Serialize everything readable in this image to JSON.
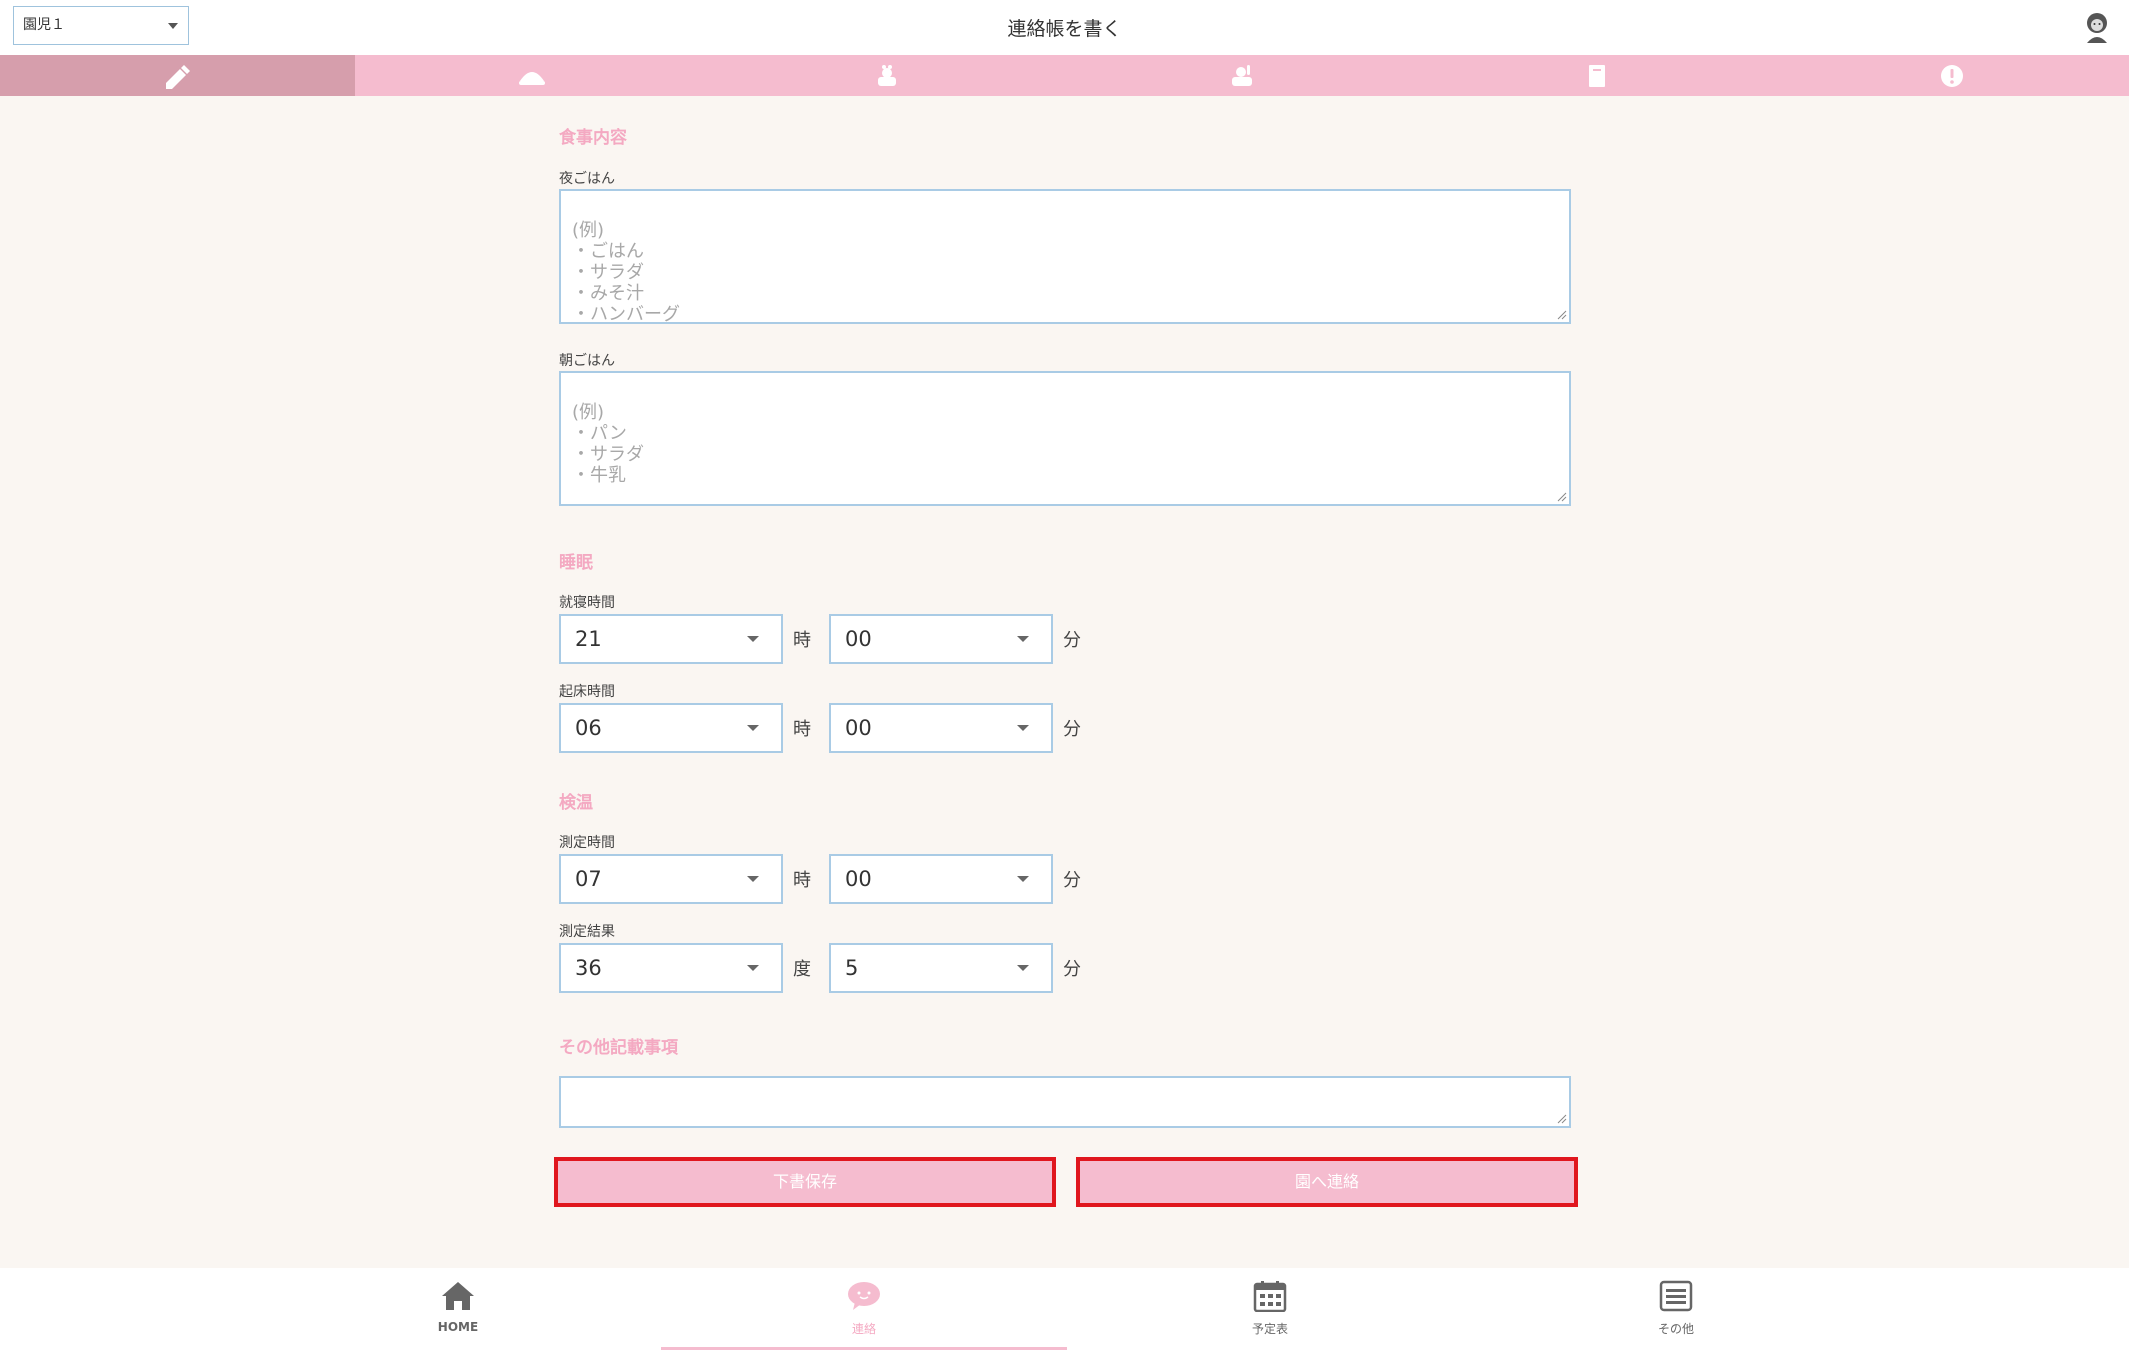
{
  "header": {
    "child_select": "園児１",
    "title": "連絡帳を書く"
  },
  "tabs": [
    {
      "name": "pencil-icon"
    },
    {
      "name": "meal-icon"
    },
    {
      "name": "sleep-icon"
    },
    {
      "name": "temperature-icon"
    },
    {
      "name": "notebook-icon"
    },
    {
      "name": "alert-icon"
    }
  ],
  "meal": {
    "section_title": "食事内容",
    "dinner_label": "夜ごはん",
    "dinner_placeholder": "(例)\n・ごはん\n・サラダ\n・みそ汁\n・ハンバーグ",
    "breakfast_label": "朝ごはん",
    "breakfast_placeholder": "(例)\n・パン\n・サラダ\n・牛乳"
  },
  "sleep": {
    "section_title": "睡眠",
    "bedtime_label": "就寝時間",
    "bedtime_hour": "21",
    "bedtime_minute": "00",
    "wake_label": "起床時間",
    "wake_hour": "06",
    "wake_minute": "00",
    "hour_unit": "時",
    "minute_unit": "分"
  },
  "temperature": {
    "section_title": "検温",
    "time_label": "測定時間",
    "time_hour": "07",
    "time_minute": "00",
    "result_label": "測定結果",
    "result_degree": "36",
    "result_decimal": "5",
    "hour_unit": "時",
    "minute_unit": "分",
    "degree_unit": "度",
    "decimal_unit": "分"
  },
  "notes": {
    "section_title": "その他記載事項"
  },
  "buttons": {
    "save_draft": "下書保存",
    "send": "園へ連絡"
  },
  "bottom_nav": [
    {
      "label": "HOME"
    },
    {
      "label": "連絡"
    },
    {
      "label": "予定表"
    },
    {
      "label": "その他"
    }
  ],
  "colors": {
    "accent_pink": "#f5bccf",
    "active_tab": "#d69eac",
    "section_title": "#f4a9c2",
    "input_border": "#a9cbe5",
    "highlight_border": "#e0161e"
  }
}
